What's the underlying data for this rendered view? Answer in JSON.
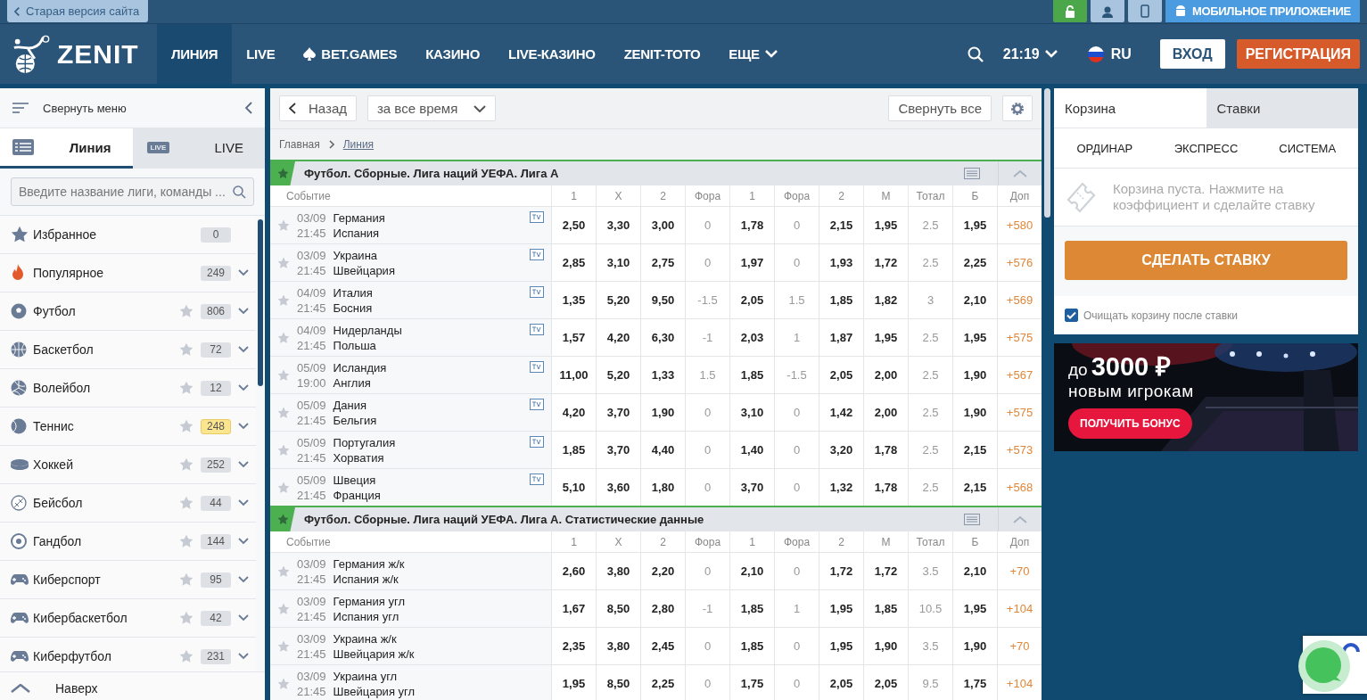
{
  "topbar": {
    "old_site": "Старая версия сайта",
    "app_button": "МОБИЛЬНОЕ ПРИЛОЖЕНИЕ"
  },
  "header": {
    "logo": "ZENIT",
    "nav": [
      {
        "label": "ЛИНИЯ",
        "selected": true,
        "kind": "plain"
      },
      {
        "label": "LIVE",
        "selected": false,
        "kind": "plain"
      },
      {
        "label": "BET.GAMES",
        "selected": false,
        "kind": "spade"
      },
      {
        "label": "КАЗИНО",
        "selected": false,
        "kind": "plain"
      },
      {
        "label": "LIVE-КАЗИНО",
        "selected": false,
        "kind": "plain"
      },
      {
        "label": "ZENIT-TOTO",
        "selected": false,
        "kind": "plain"
      },
      {
        "label": "ЕЩЕ",
        "selected": false,
        "kind": "more"
      }
    ],
    "time": "21:19",
    "language": "RU",
    "login": "ВХОД",
    "register": "РЕГИСТРАЦИЯ"
  },
  "sidebar": {
    "collapse": "Свернуть меню",
    "tabs": [
      {
        "label": "Линия",
        "selected": true,
        "kind": "list"
      },
      {
        "label": "LIVE",
        "badge": "LIVE",
        "selected": false,
        "kind": "live"
      }
    ],
    "search": {
      "placeholder": "Введите название лиги, команды ..."
    },
    "items": [
      {
        "label": "Избранное",
        "count": "0",
        "kind": "favorites",
        "starrable": false,
        "expandable": false,
        "highlighted": false
      },
      {
        "label": "Популярное",
        "count": "249",
        "kind": "popular",
        "starrable": false,
        "expandable": true,
        "highlighted": false
      },
      {
        "label": "Футбол",
        "count": "806",
        "kind": "football",
        "starrable": true,
        "expandable": true,
        "highlighted": false
      },
      {
        "label": "Баскетбол",
        "count": "72",
        "kind": "basketball",
        "starrable": true,
        "expandable": true,
        "highlighted": false
      },
      {
        "label": "Волейбол",
        "count": "12",
        "kind": "volleyball",
        "starrable": true,
        "expandable": true,
        "highlighted": false
      },
      {
        "label": "Теннис",
        "count": "248",
        "kind": "tennis",
        "starrable": true,
        "expandable": true,
        "highlighted": true
      },
      {
        "label": "Хоккей",
        "count": "252",
        "kind": "hockey",
        "starrable": true,
        "expandable": true,
        "highlighted": false
      },
      {
        "label": "Бейсбол",
        "count": "44",
        "kind": "baseball",
        "starrable": true,
        "expandable": true,
        "highlighted": false
      },
      {
        "label": "Гандбол",
        "count": "144",
        "kind": "handball",
        "starrable": true,
        "expandable": true,
        "highlighted": false
      },
      {
        "label": "Киберспорт",
        "count": "95",
        "kind": "esports",
        "starrable": true,
        "expandable": true,
        "highlighted": false
      },
      {
        "label": "Кибербаскетбол",
        "count": "42",
        "kind": "esports",
        "starrable": true,
        "expandable": true,
        "highlighted": false
      },
      {
        "label": "Киберфутбол",
        "count": "231",
        "kind": "esports",
        "starrable": true,
        "expandable": true,
        "highlighted": false
      }
    ],
    "to_top": "Наверх"
  },
  "toolbar": {
    "back": "Назад",
    "period": "за все время",
    "collapse_all": "Свернуть все"
  },
  "breadcrumbs": [
    {
      "label": "Главная",
      "kind": "text"
    },
    {
      "label": "Линия",
      "kind": "link"
    }
  ],
  "sections": [
    {
      "title": "Футбол. Сборные. Лига наций УЕФА. Лига А",
      "favorite": true,
      "expanded": true,
      "columns": [
        {
          "label": "Событие",
          "kind": "event"
        },
        {
          "label": "1",
          "kind": "odd"
        },
        {
          "label": "X",
          "kind": "odd"
        },
        {
          "label": "2",
          "kind": "odd"
        },
        {
          "label": "Фора",
          "kind": "param"
        },
        {
          "label": "1",
          "kind": "odd"
        },
        {
          "label": "Фора",
          "kind": "param"
        },
        {
          "label": "2",
          "kind": "odd"
        },
        {
          "label": "М",
          "kind": "odd"
        },
        {
          "label": "Тотал",
          "kind": "param"
        },
        {
          "label": "Б",
          "kind": "odd"
        },
        {
          "label": "Доп",
          "kind": "extra"
        }
      ],
      "rows": [
        {
          "date": "03/09",
          "time": "21:45",
          "home": "Германия",
          "away": "Испания",
          "tv": true,
          "favorite": false,
          "odds": [
            "2,50",
            "3,30",
            "3,00",
            "0",
            "1,78",
            "0",
            "2,15",
            "1,95",
            "2.5",
            "1,95",
            "+580"
          ]
        },
        {
          "date": "03/09",
          "time": "21:45",
          "home": "Украина",
          "away": "Швейцария",
          "tv": true,
          "favorite": false,
          "odds": [
            "2,85",
            "3,10",
            "2,75",
            "0",
            "1,97",
            "0",
            "1,93",
            "1,72",
            "2.5",
            "2,25",
            "+576"
          ]
        },
        {
          "date": "04/09",
          "time": "21:45",
          "home": "Италия",
          "away": "Босния",
          "tv": true,
          "favorite": false,
          "odds": [
            "1,35",
            "5,20",
            "9,50",
            "-1.5",
            "2,05",
            "1.5",
            "1,85",
            "1,82",
            "3",
            "2,10",
            "+569"
          ]
        },
        {
          "date": "04/09",
          "time": "21:45",
          "home": "Нидерланды",
          "away": "Польша",
          "tv": true,
          "favorite": false,
          "odds": [
            "1,57",
            "4,20",
            "6,30",
            "-1",
            "2,03",
            "1",
            "1,87",
            "1,95",
            "2.5",
            "1,95",
            "+575"
          ]
        },
        {
          "date": "05/09",
          "time": "19:00",
          "home": "Исландия",
          "away": "Англия",
          "tv": true,
          "favorite": false,
          "odds": [
            "11,00",
            "5,20",
            "1,33",
            "1.5",
            "1,85",
            "-1.5",
            "2,05",
            "2,00",
            "2.5",
            "1,90",
            "+567"
          ]
        },
        {
          "date": "05/09",
          "time": "21:45",
          "home": "Дания",
          "away": "Бельгия",
          "tv": true,
          "favorite": false,
          "odds": [
            "4,20",
            "3,70",
            "1,90",
            "0",
            "3,10",
            "0",
            "1,42",
            "2,00",
            "2.5",
            "1,90",
            "+575"
          ]
        },
        {
          "date": "05/09",
          "time": "21:45",
          "home": "Португалия",
          "away": "Хорватия",
          "tv": true,
          "favorite": false,
          "odds": [
            "1,85",
            "3,70",
            "4,40",
            "0",
            "1,40",
            "0",
            "3,20",
            "1,78",
            "2.5",
            "2,15",
            "+573"
          ]
        },
        {
          "date": "05/09",
          "time": "21:45",
          "home": "Швеция",
          "away": "Франция",
          "tv": true,
          "favorite": false,
          "odds": [
            "5,10",
            "3,60",
            "1,80",
            "0",
            "3,70",
            "0",
            "1,32",
            "1,78",
            "2.5",
            "2,15",
            "+568"
          ]
        }
      ]
    },
    {
      "title": "Футбол. Сборные. Лига наций УЕФА. Лига А. Статистические данные",
      "favorite": true,
      "expanded": true,
      "columns": [
        {
          "label": "Событие",
          "kind": "event"
        },
        {
          "label": "1",
          "kind": "odd"
        },
        {
          "label": "X",
          "kind": "odd"
        },
        {
          "label": "2",
          "kind": "odd"
        },
        {
          "label": "Фора",
          "kind": "param"
        },
        {
          "label": "1",
          "kind": "odd"
        },
        {
          "label": "Фора",
          "kind": "param"
        },
        {
          "label": "2",
          "kind": "odd"
        },
        {
          "label": "М",
          "kind": "odd"
        },
        {
          "label": "Тотал",
          "kind": "param"
        },
        {
          "label": "Б",
          "kind": "odd"
        },
        {
          "label": "Доп",
          "kind": "extra"
        }
      ],
      "rows": [
        {
          "date": "03/09",
          "time": "21:45",
          "home": "Германия ж/к",
          "away": "Испания ж/к",
          "tv": false,
          "favorite": false,
          "odds": [
            "2,60",
            "3,80",
            "2,20",
            "0",
            "2,10",
            "0",
            "1,72",
            "1,72",
            "3.5",
            "2,10",
            "+70"
          ]
        },
        {
          "date": "03/09",
          "time": "21:45",
          "home": "Германия угл",
          "away": "Испания угл",
          "tv": false,
          "favorite": false,
          "odds": [
            "1,67",
            "8,50",
            "2,80",
            "-1",
            "1,85",
            "1",
            "1,95",
            "1,85",
            "10.5",
            "1,95",
            "+104"
          ]
        },
        {
          "date": "03/09",
          "time": "21:45",
          "home": "Украина ж/к",
          "away": "Швейцария ж/к",
          "tv": false,
          "favorite": false,
          "odds": [
            "2,35",
            "3,80",
            "2,45",
            "0",
            "1,85",
            "0",
            "1,95",
            "1,90",
            "3.5",
            "1,90",
            "+70"
          ]
        },
        {
          "date": "03/09",
          "time": "21:45",
          "home": "Украина угл",
          "away": "Швейцария угл",
          "tv": false,
          "favorite": false,
          "odds": [
            "1,95",
            "8,50",
            "2,25",
            "0",
            "1,75",
            "0",
            "2,05",
            "2,05",
            "9.5",
            "1,75",
            "+104"
          ]
        }
      ]
    }
  ],
  "betslip": {
    "tabs": [
      {
        "label": "Корзина",
        "selected": true
      },
      {
        "label": "Ставки",
        "selected": false
      }
    ],
    "types": [
      "ОРДИНАР",
      "ЭКСПРЕСС",
      "СИСТЕМА"
    ],
    "empty_message": "Корзина пуста. Нажмите на коэффициент и сделайте ставку",
    "submit": "СДЕЛАТЬ СТАВКУ",
    "clear_after": {
      "label": "Очищать корзину после ставки",
      "checked": true
    }
  },
  "banner": {
    "kind": "picture",
    "prefix": "до",
    "amount": "3000 ₽",
    "subtitle": "новым игрокам",
    "button": "ПОЛУЧИТЬ БОНУС"
  }
}
